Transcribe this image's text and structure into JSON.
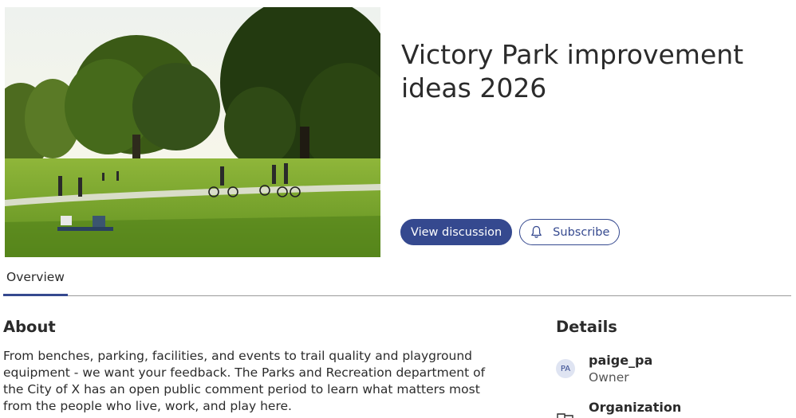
{
  "hero": {
    "title": "Victory Park improvement ideas 2026"
  },
  "actions": {
    "view_discussion_label": "View discussion",
    "subscribe_label": "Subscribe"
  },
  "tabs": [
    {
      "label": "Overview",
      "active": true
    }
  ],
  "about": {
    "heading": "About",
    "text": "From benches, parking, facilities, and events to trail quality and playground equipment - we want your feedback. The Parks and Recreation department of the City of X has an open public comment period to learn what matters most from the people who live, work, and play here."
  },
  "details": {
    "heading": "Details",
    "owner": {
      "initials": "PA",
      "name": "paige_pa",
      "role": "Owner"
    },
    "organization_label": "Organization"
  },
  "colors": {
    "accent": "#35498f",
    "text": "#2b2b2b",
    "avatar_bg": "#dfe4f2"
  },
  "icons": {
    "subscribe": "bell-icon",
    "organization": "building-icon"
  }
}
